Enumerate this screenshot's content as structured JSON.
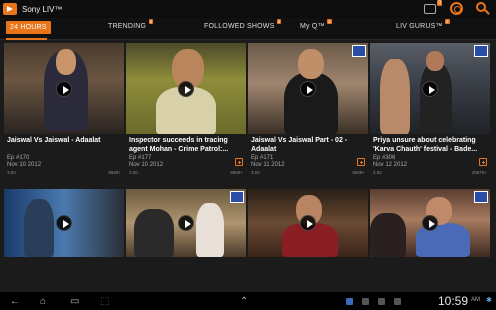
{
  "app": {
    "title": "Sony LIV™",
    "notif_count": "9"
  },
  "tabs": [
    {
      "label": "24 HOURS",
      "active": true,
      "badge": ""
    },
    {
      "label": "TRENDING",
      "badge": "8"
    },
    {
      "label": "FOLLOWED SHOWS",
      "badge": "8"
    },
    {
      "label": "My Q™",
      "badge": "8"
    },
    {
      "label": "LIV GURUS™",
      "badge": "8"
    }
  ],
  "cards": [
    {
      "title": "Jaiswal Vs Jaiswal  - Adaalat",
      "episode": "Ep #170",
      "date": "Nov 10 2012",
      "rating": "3.50",
      "views": "9668+"
    },
    {
      "title": "Inspector succeeds in tracing agent Mohan  - Crime Patrol:...",
      "episode": "Ep #177",
      "date": "Nov 10 2012",
      "rating": "3.50",
      "views": "9906+"
    },
    {
      "title": "Jaiswal Vs Jaiswal Part - 02  - Adaalat",
      "episode": "Ep #171",
      "date": "Nov 11 2012",
      "rating": "3.50",
      "views": "9668+"
    },
    {
      "title": "Priya unsure about celebrating 'Karva Chauth' festival  - Bade...",
      "episode": "Ep #306",
      "date": "Nov 12 2012",
      "rating": "3.50",
      "views": "26875+"
    }
  ],
  "system": {
    "time": "10:59",
    "ampm": "AM"
  }
}
